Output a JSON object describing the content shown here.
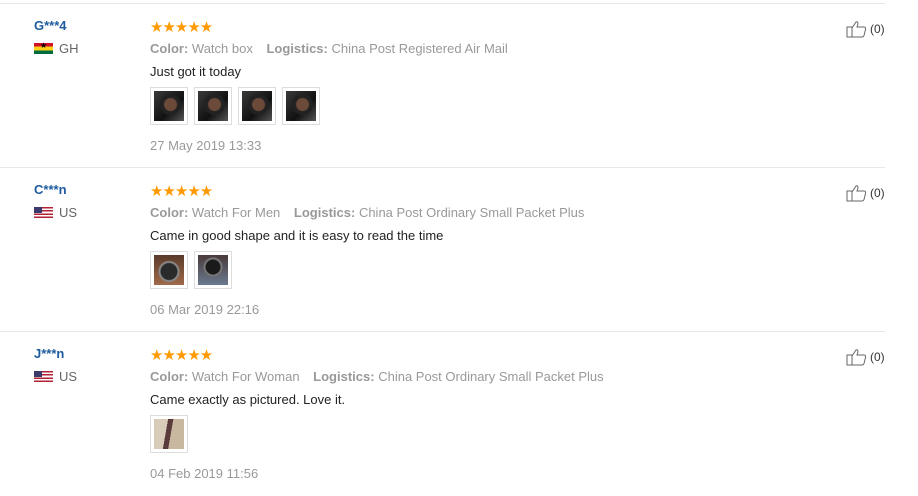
{
  "labels": {
    "color": "Color:",
    "logistics": "Logistics:"
  },
  "colors": {
    "star": "#ff9a00",
    "username": "#1d5b9e",
    "muted": "#999999"
  },
  "reviews": [
    {
      "user": "G***4",
      "country": "GH",
      "flag": "ghana-flag-icon",
      "stars": "★★★★★",
      "rating": 5,
      "color": "Watch box",
      "logistics": "China Post Registered Air Mail",
      "content": "Just got it today",
      "photos": 4,
      "date": "27 May 2019 13:33",
      "helpful": "(0)"
    },
    {
      "user": "C***n",
      "country": "US",
      "flag": "us-flag-icon",
      "stars": "★★★★★",
      "rating": 5,
      "color": "Watch For Men",
      "logistics": "China Post Ordinary Small Packet Plus",
      "content": "Came in good shape and it is easy to read the time",
      "photos": 2,
      "date": "06 Mar 2019 22:16",
      "helpful": "(0)"
    },
    {
      "user": "J***n",
      "country": "US",
      "flag": "us-flag-icon",
      "stars": "★★★★★",
      "rating": 5,
      "color": "Watch For Woman",
      "logistics": "China Post Ordinary Small Packet Plus",
      "content": "Came exactly as pictured. Love it.",
      "photos": 1,
      "date": "04 Feb 2019 11:56",
      "helpful": "(0)"
    }
  ]
}
